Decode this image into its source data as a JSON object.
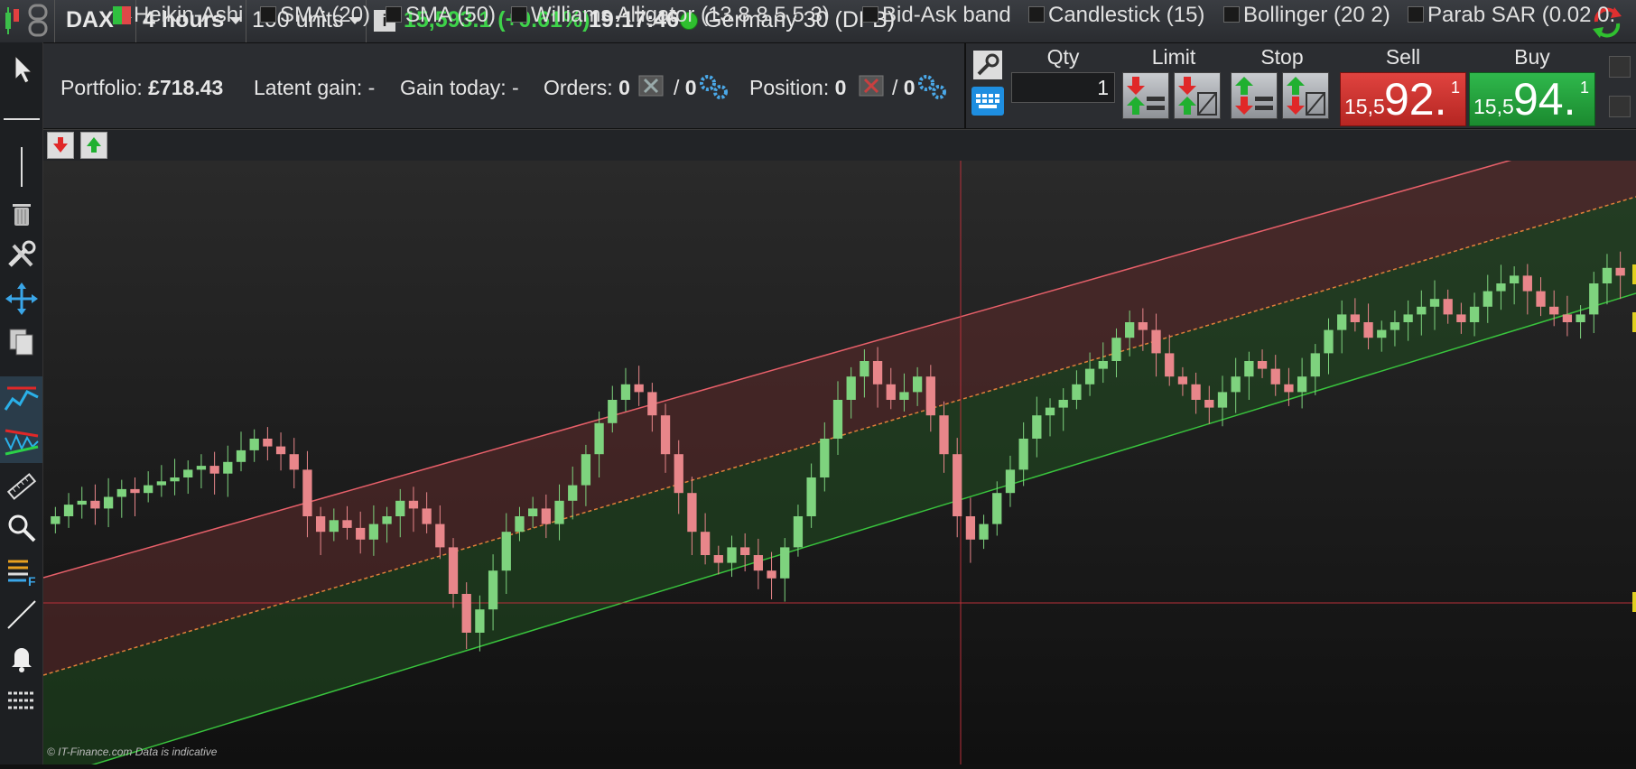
{
  "topbar": {
    "instrument": "DAX",
    "timeframe": "4 hours",
    "units": "100 units",
    "price": "15,593.1",
    "change": "(+0.61%)",
    "time": "19:17:46",
    "market_name": "Germany 30 (DFB)"
  },
  "portfolio": {
    "portfolio_label": "Portfolio:",
    "portfolio_value": "£718.43",
    "latent_gain": "Latent gain: -",
    "gain_today": "Gain today: -",
    "orders_label": "Orders:",
    "orders_count": "0",
    "orders_sep": "/",
    "orders_total": "0",
    "position_label": "Position:",
    "position_count": "0",
    "position_sep": "/",
    "position_total": "0"
  },
  "order_panel": {
    "qty_label": "Qty",
    "qty_value": "1",
    "limit_label": "Limit",
    "stop_label": "Stop",
    "sell_label": "Sell",
    "buy_label": "Buy",
    "sell_small": "15,5",
    "sell_big": "92.",
    "sell_sup": "1",
    "buy_small": "15,5",
    "buy_big": "94.",
    "buy_sup": "1"
  },
  "indicators": {
    "heikin": "Heikin-Ashi",
    "sma20": "SMA (20)",
    "sma50": "SMA (50)",
    "alligator": "Williams Alligator (13 8 8 5 5 3)",
    "bidask": "Bid-Ask band",
    "candlestick": "Candlestick (15)",
    "bollinger": "Bollinger (20 2)",
    "parab": "Parab SAR (0.02 0."
  },
  "chart": {
    "copyright": "© IT-Finance.com  Data is indicative",
    "colors": {
      "up": "#7ed37e",
      "down": "#e8868a",
      "upper_line": "#e8606a",
      "lower_line": "#39c43d",
      "mid_line": "#e0803a",
      "crosshair": "#b8303a"
    }
  },
  "chart_data": {
    "type": "candlestick",
    "title": "",
    "candles_close_estimate": [
      15300,
      15315,
      15320,
      15310,
      15325,
      15335,
      15330,
      15340,
      15345,
      15350,
      15360,
      15365,
      15355,
      15370,
      15385,
      15400,
      15390,
      15380,
      15360,
      15300,
      15280,
      15295,
      15285,
      15270,
      15290,
      15300,
      15320,
      15310,
      15290,
      15260,
      15200,
      15150,
      15180,
      15230,
      15280,
      15300,
      15310,
      15290,
      15320,
      15340,
      15380,
      15420,
      15450,
      15470,
      15460,
      15430,
      15380,
      15330,
      15280,
      15250,
      15240,
      15260,
      15250,
      15230,
      15220,
      15260,
      15300,
      15350,
      15400,
      15450,
      15480,
      15500,
      15470,
      15450,
      15460,
      15480,
      15430,
      15380,
      15300,
      15270,
      15290,
      15330,
      15360,
      15400,
      15430,
      15440,
      15450,
      15470,
      15490,
      15500,
      15530,
      15550,
      15540,
      15510,
      15480,
      15470,
      15450,
      15440,
      15460,
      15480,
      15500,
      15490,
      15470,
      15460,
      15480,
      15510,
      15540,
      15560,
      15550,
      15530,
      15540,
      15550,
      15560,
      15570,
      15580,
      15560,
      15550,
      15570,
      15590,
      15600,
      15610,
      15590,
      15570,
      15560,
      15550,
      15560,
      15600,
      15620,
      15610
    ]
  }
}
